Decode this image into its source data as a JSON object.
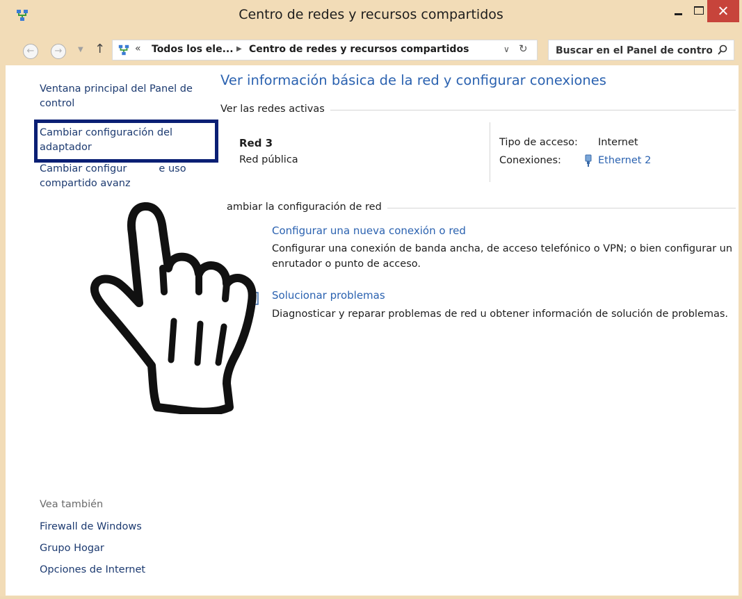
{
  "window": {
    "title": "Centro de redes y recursos compartidos",
    "close_color": "#c7443b"
  },
  "address_bar": {
    "overflow": "«",
    "crumb1": "Todos los ele...",
    "crumb2": "Centro de redes y recursos compartidos"
  },
  "search": {
    "placeholder": "Buscar en el Panel de control"
  },
  "sidebar": {
    "links": [
      "Ventana principal del Panel de control",
      "Cambiar configuración del adaptador",
      "Cambiar configuración de uso compartido avanzado"
    ],
    "link3_visible": "Cambiar configur          e uso\ncompartido avanz",
    "see_also_heading": "Vea también",
    "see_also": [
      "Firewall de Windows",
      "Grupo Hogar",
      "Opciones de Internet"
    ]
  },
  "main": {
    "title": "Ver información básica de la red y configurar conexiones",
    "active_networks_heading": "Ver las redes activas",
    "network": {
      "name": "Red 3",
      "category": "Red pública",
      "access_type_label": "Tipo de acceso:",
      "access_type_value": "Internet",
      "connections_label": "Conexiones:",
      "connection_link": "Ethernet 2"
    },
    "change_settings_heading": "ambiar la configuración de red",
    "tasks": [
      {
        "link": "Configurar una nueva conexión o red",
        "description": "Configurar una conexión de banda ancha, de acceso telefónico o VPN; o bien configurar un enrutador o punto de acceso."
      },
      {
        "link": "Solucionar problemas",
        "description": "Diagnosticar y reparar problemas de red u obtener información de solución de problemas."
      }
    ]
  },
  "colors": {
    "window_frame": "#f2dcb7",
    "link_blue": "#2b62b0",
    "sidebar_link": "#1c3a70",
    "highlight_box": "#0a1f74"
  },
  "icons": [
    "network-icon",
    "back-icon",
    "forward-icon",
    "up-arrow-icon",
    "refresh-icon",
    "search-icon",
    "ethernet-icon",
    "troubleshoot-icon",
    "pointing-hand-icon"
  ]
}
